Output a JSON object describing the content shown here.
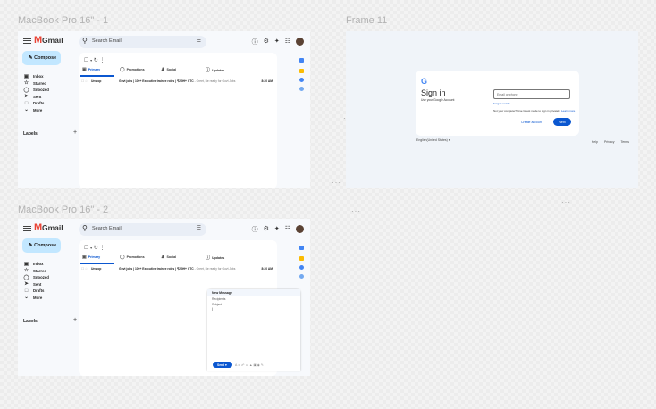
{
  "frames": {
    "gmail1_label": "MacBook Pro 16\" - 1",
    "signin_label": "Frame 11",
    "gmail2_label": "MacBook Pro 16\" - 2"
  },
  "gmail": {
    "app_name": "Gmail",
    "search_placeholder": "Search Email",
    "compose_label": "Compose",
    "nav": [
      {
        "icon": "inbox-icon",
        "label": "Inbox"
      },
      {
        "icon": "star-icon",
        "label": "Starred"
      },
      {
        "icon": "clock-icon",
        "label": "Snoozed"
      },
      {
        "icon": "send-icon",
        "label": "Sent"
      },
      {
        "icon": "draft-icon",
        "label": "Drafts"
      },
      {
        "icon": "chevron-down-icon",
        "label": "More"
      }
    ],
    "labels_heading": "Labels",
    "tabs": [
      "Primary",
      "Promotions",
      "Social",
      "Updates"
    ],
    "row": {
      "sender": "Unstop",
      "subject": "Govt jobs | 100+ Executive trainee roles | ₹2.0H+ CTC",
      "snippet": " - Greet, Be ready for Govt Jobs",
      "time": "8:20 AM"
    }
  },
  "compose_window": {
    "title": "New Message",
    "recipients": "Recipients",
    "subject": "Subject",
    "cursor": "|",
    "send_label": "Send"
  },
  "signin": {
    "logo": "G",
    "title": "Sign in",
    "subtitle": "Use your Google Account",
    "email_placeholder": "Email or phone",
    "forgot": "Forgot email?",
    "guest_text": "Not your computer? Use Guest mode to sign in privately.",
    "learn_more": "Learn more",
    "create_account": "Create account",
    "next": "Next",
    "language": "English(United States)",
    "footer": [
      "Help",
      "Privacy",
      "Terms"
    ]
  },
  "colors": {
    "accent": "#0b57d0",
    "compose": "#c2e7ff",
    "gmail_red": "#ea4335"
  }
}
